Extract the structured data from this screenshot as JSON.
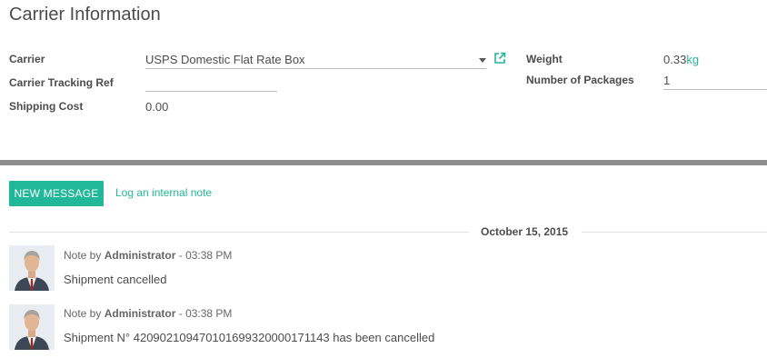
{
  "section": {
    "title": "Carrier Information"
  },
  "left_fields": {
    "carrier": {
      "label": "Carrier",
      "value": "USPS Domestic Flat Rate Box"
    },
    "tracking": {
      "label": "Carrier Tracking Ref",
      "value": ""
    },
    "cost": {
      "label": "Shipping Cost",
      "value": "0.00"
    }
  },
  "right_fields": {
    "weight": {
      "label": "Weight",
      "value": "0.33",
      "unit": "kg"
    },
    "packages": {
      "label": "Number of Packages",
      "value": "1"
    }
  },
  "chatter": {
    "new_message": "NEW MESSAGE",
    "log_note": "Log an internal note",
    "date": "October 15, 2015",
    "messages": [
      {
        "prefix": "Note by",
        "author": "Administrator",
        "time": "- 03:38 PM",
        "body": "Shipment cancelled"
      },
      {
        "prefix": "Note by",
        "author": "Administrator",
        "time": "- 03:38 PM",
        "body": "Shipment N° 420902109470101699320000171143 has been cancelled"
      }
    ]
  },
  "colors": {
    "accent": "#21b799",
    "divider": "#8f8f8f",
    "text": "#4c4c4c"
  },
  "icons": {
    "external_link": "external-link-icon",
    "dropdown": "caret-down-icon"
  }
}
